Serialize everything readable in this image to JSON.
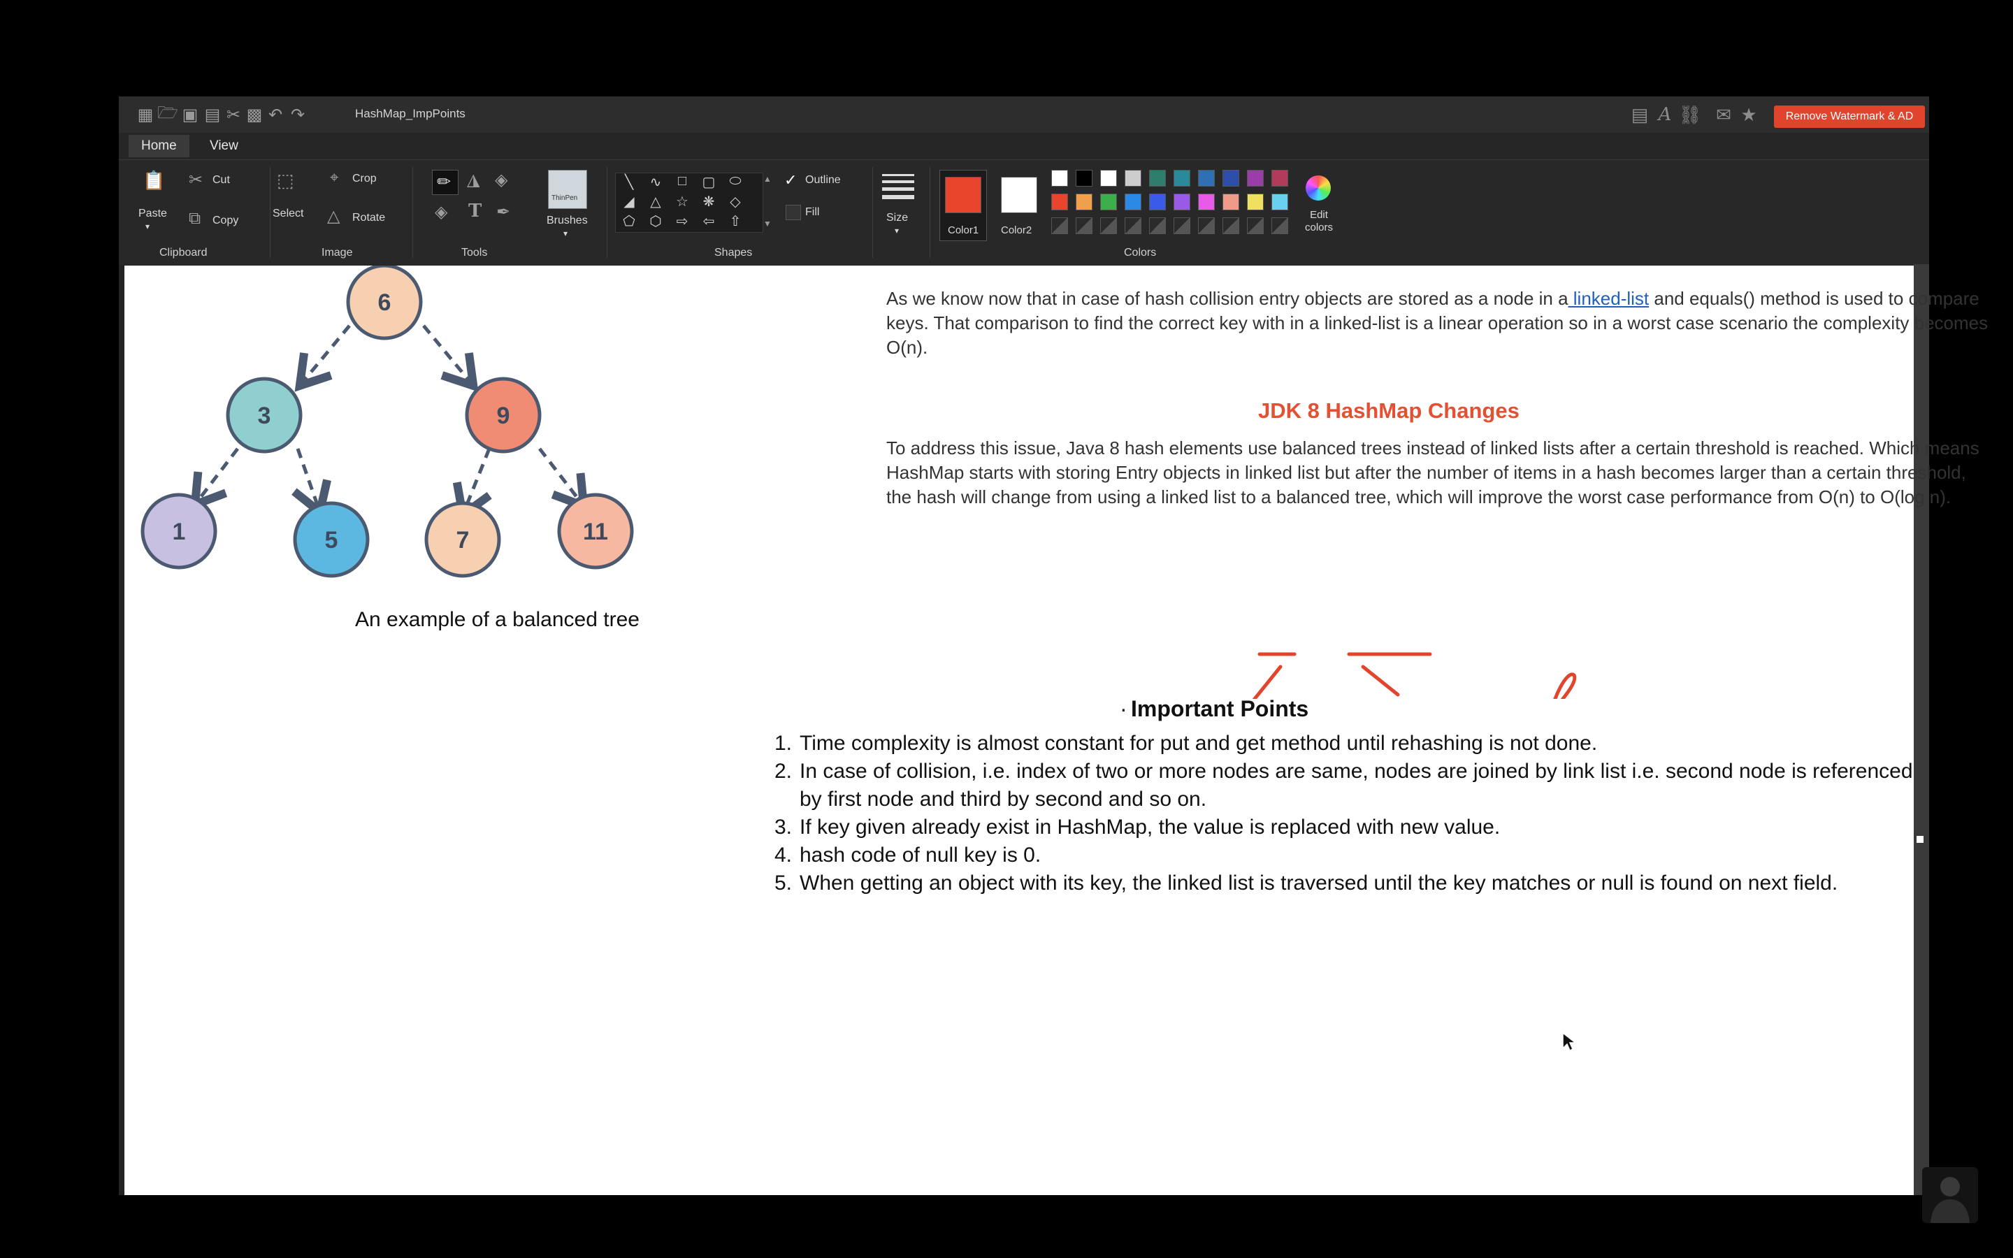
{
  "window": {
    "title": "HashMap_ImpPoints",
    "watermark_button": "Remove Watermark & AD"
  },
  "tabs": [
    "Home",
    "View"
  ],
  "ribbon": {
    "clipboard": {
      "paste": "Paste",
      "cut": "Cut",
      "copy": "Copy",
      "label": "Clipboard"
    },
    "image": {
      "select": "Select",
      "crop": "Crop",
      "rotate": "Rotate",
      "label": "Image"
    },
    "tools": {
      "label": "Tools",
      "text_tool": "T"
    },
    "brushes": {
      "label": "Brushes",
      "thumb_text": "ThinPen"
    },
    "shapes": {
      "label": "Shapes",
      "outline": "Outline",
      "fill": "Fill"
    },
    "size": {
      "label": "Size"
    },
    "colors": {
      "label": "Colors",
      "color1_label": "Color1",
      "color2_label": "Color2",
      "edit_label": "Edit colors",
      "color1": "#e8452c",
      "color2": "#ffffff",
      "row1": [
        "#ffffff",
        "#000000",
        "#ffffff",
        "#cccccc",
        "#2f7d6c",
        "#2a8a9c",
        "#2f6fb3",
        "#2c4ea8",
        "#9b3da8",
        "#b23a5a"
      ],
      "row2": [
        "#e8452c",
        "#f0a04a",
        "#3bb04a",
        "#2a8ae6",
        "#3a5ae8",
        "#9a5ae8",
        "#e85ae8",
        "#f09a8a",
        "#f0e060",
        "#6ad0f0"
      ]
    }
  },
  "tree": {
    "nodes": [
      {
        "label": "6",
        "fill": "#f6d0b0"
      },
      {
        "label": "3",
        "fill": "#8fcfcf"
      },
      {
        "label": "9",
        "fill": "#f08c74"
      },
      {
        "label": "1",
        "fill": "#c8c0e0"
      },
      {
        "label": "5",
        "fill": "#5cb8e0"
      },
      {
        "label": "7",
        "fill": "#f6d0b0"
      },
      {
        "label": "11",
        "fill": "#f6b8a0"
      }
    ],
    "caption": "An example of a balanced tree"
  },
  "content": {
    "intro_before": "As we know now that in case of hash collision entry objects are stored as a node in a",
    "intro_link": " linked-list",
    "intro_after": " and equals() method is used to compare keys. That comparison to find the correct key with in a linked-list is a linear operation so in a worst case scenario the complexity becomes O(n).",
    "heading": "JDK 8 HashMap Changes",
    "para2": "To address this issue, Java 8 hash elements use balanced trees instead of linked lists after a certain threshold is reached. Which means HashMap starts with storing Entry objects in linked list but after the number of items in a hash becomes larger than a certain threshold, the hash will change from using a linked list to a balanced tree, which will improve the worst case performance from O(n) to O(log n).",
    "bullet": "·",
    "important_title": "Important Points",
    "points": [
      "Time complexity is almost constant for put and get method until rehashing is not done.",
      "In case of collision, i.e. index of two or more nodes are same, nodes are joined by link list i.e. second node is referenced by first node and third by second and so on.",
      "If key given already exist in HashMap, the value is replaced with new value.",
      "hash code of null key is 0.",
      "When getting an object with its key, the linked list is traversed until the key matches or null is found on next field."
    ],
    "point_numbers": [
      "1.",
      "2.",
      "3.",
      "4.",
      "5."
    ]
  }
}
